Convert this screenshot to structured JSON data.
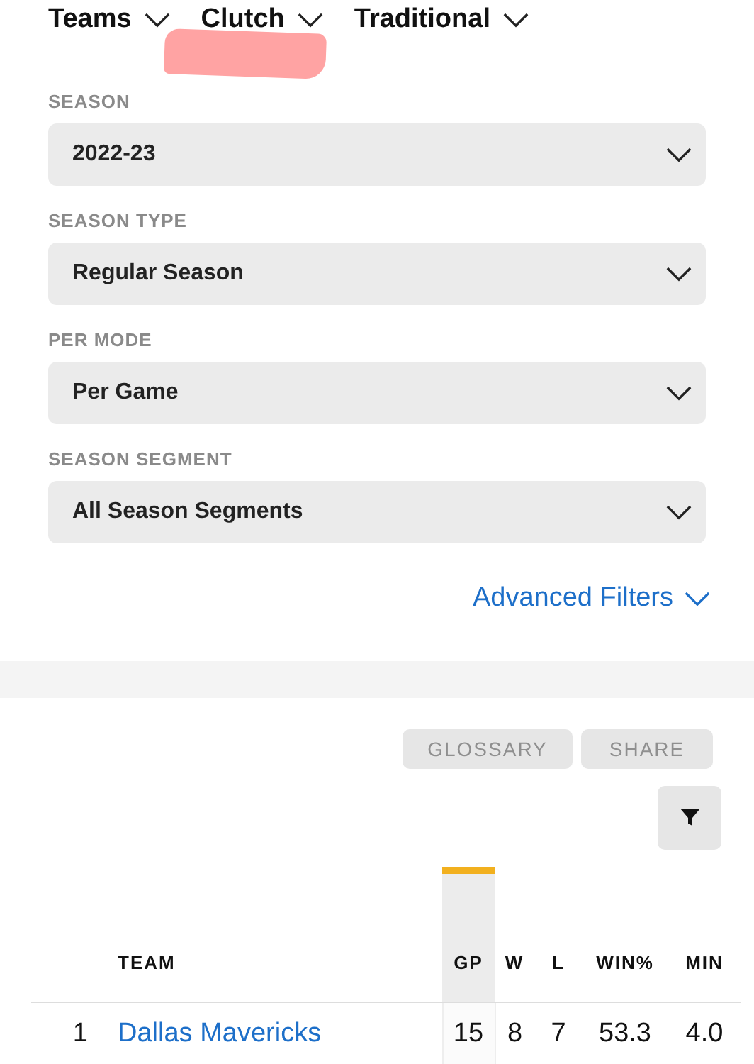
{
  "nav": [
    {
      "label": "Teams"
    },
    {
      "label": "Clutch"
    },
    {
      "label": "Traditional"
    }
  ],
  "filters": [
    {
      "label": "SEASON",
      "value": "2022-23"
    },
    {
      "label": "SEASON TYPE",
      "value": "Regular Season"
    },
    {
      "label": "PER MODE",
      "value": "Per Game"
    },
    {
      "label": "SEASON SEGMENT",
      "value": "All Season Segments"
    }
  ],
  "advanced_filters": "Advanced Filters",
  "buttons": [
    "GLOSSARY",
    "SHARE"
  ],
  "table": {
    "columns": [
      {
        "kind": "rank"
      },
      {
        "kind": "team",
        "label": "TEAM",
        "sorted": false
      },
      {
        "kind": "stat",
        "label": "GP",
        "sorted": true
      },
      {
        "kind": "stat",
        "label": "W",
        "sorted": false
      },
      {
        "kind": "stat",
        "label": "L",
        "sorted": false
      },
      {
        "kind": "stat",
        "label": "WIN%",
        "sorted": false
      },
      {
        "kind": "stat",
        "label": "MIN",
        "sorted": false
      }
    ],
    "rows": [
      {
        "cells": [
          "1",
          "Dallas Mavericks",
          "15",
          "8",
          "7",
          "53.3",
          "4.0"
        ]
      }
    ]
  }
}
